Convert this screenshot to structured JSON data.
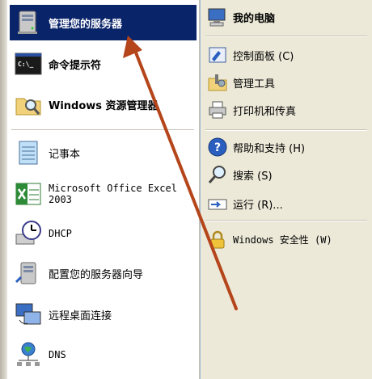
{
  "left_items": [
    {
      "id": "manage-server",
      "label": "管理您的服务器",
      "icon": "server-icon"
    },
    {
      "id": "command-prompt",
      "label": "命令提示符",
      "icon": "command-prompt-icon"
    },
    {
      "id": "windows-explorer",
      "label": "Windows 资源管理器",
      "icon": "folder-magnifier-icon"
    },
    {
      "id": "notepad",
      "label": "记事本",
      "icon": "notepad-icon"
    },
    {
      "id": "excel",
      "label_line1": "Microsoft Office Excel",
      "label_line2": "2003",
      "icon": "excel-icon"
    },
    {
      "id": "dhcp",
      "label": "DHCP",
      "icon": "dhcp-clock-icon"
    },
    {
      "id": "configure-server",
      "label": "配置您的服务器向导",
      "icon": "server-wizard-icon"
    },
    {
      "id": "remote-desktop",
      "label": "远程桌面连接",
      "icon": "remote-desktop-icon"
    },
    {
      "id": "dns",
      "label": "DNS",
      "icon": "dns-globe-icon"
    }
  ],
  "right_items": [
    {
      "id": "my-computer",
      "label": "我的电脑",
      "icon": "computer-icon"
    },
    {
      "id": "control-panel",
      "label": "控制面板 (C)",
      "icon": "control-panel-icon"
    },
    {
      "id": "admin-tools",
      "label": "管理工具",
      "icon": "admin-tools-icon"
    },
    {
      "id": "printers",
      "label": "打印机和传真",
      "icon": "printer-icon"
    },
    {
      "id": "help",
      "label": "帮助和支持 (H)",
      "icon": "help-icon"
    },
    {
      "id": "search",
      "label": "搜索 (S)",
      "icon": "search-icon"
    },
    {
      "id": "run",
      "label": "运行 (R)...",
      "icon": "run-icon"
    },
    {
      "id": "security",
      "label": "Windows 安全性 (W)",
      "icon": "lock-icon"
    }
  ],
  "colors": {
    "selection": "#0a246a",
    "arrow": "#b5451b"
  }
}
